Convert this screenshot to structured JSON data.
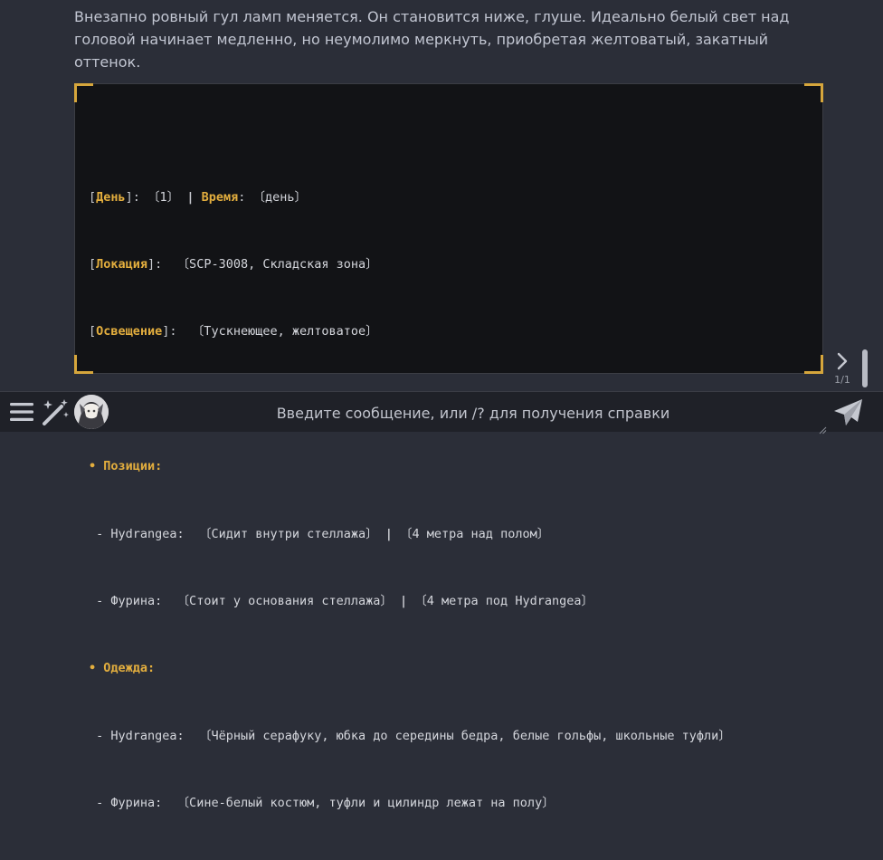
{
  "narration": "Внезапно ровный гул ламп меняется. Он становится ниже, глуше. Идеально белый свет над головой начинает медленно, но неумолимо меркнуть, приобретая желтоватый, закатный оттенок.",
  "status": {
    "day_label": "День",
    "day_value": "〔1〕",
    "time_label": "Время",
    "time_value": "〔день〕",
    "location_label": "Локация",
    "location_value": "〔SCP-3008, Складская зона〕",
    "lighting_label": "Освещение",
    "lighting_value": "〔Тускнеющее, желтоватое〕",
    "divider": "———",
    "positions_label": "• Позиции:",
    "positions": [
      {
        "name": "- Hydrangea:",
        "state": "〔Сидит внутри стеллажа〕",
        "place": "〔4 метра над полом〕"
      },
      {
        "name": "- Фурина:",
        "state": "〔Стоит у основания стеллажа〕",
        "place": "〔4 метра под Hydrangea〕"
      }
    ],
    "clothing_label": "• Одежда:",
    "clothing": [
      {
        "name": "- Hydrangea:",
        "value": "〔Чёрный серафуку, юбка до середины бедра, белые гольфы, школьные туфли〕"
      },
      {
        "name": "- Фурина:",
        "value": "〔Сине-белый костюм, туфли и цилиндр лежат на полу〕"
      }
    ]
  },
  "swipe_counter": "1/1",
  "input": {
    "placeholder": "Введите сообщение, или /? для получения справки",
    "value": ""
  },
  "icons": {
    "menu": "hamburger-icon",
    "wand": "magic-wand-icon",
    "send": "send-icon",
    "swipe": "chevron-right-icon"
  },
  "colors": {
    "background": "#2b2e38",
    "code_background": "#121316",
    "accent_gold": "#e3ae3e",
    "bottom_bar": "#1f2128"
  }
}
